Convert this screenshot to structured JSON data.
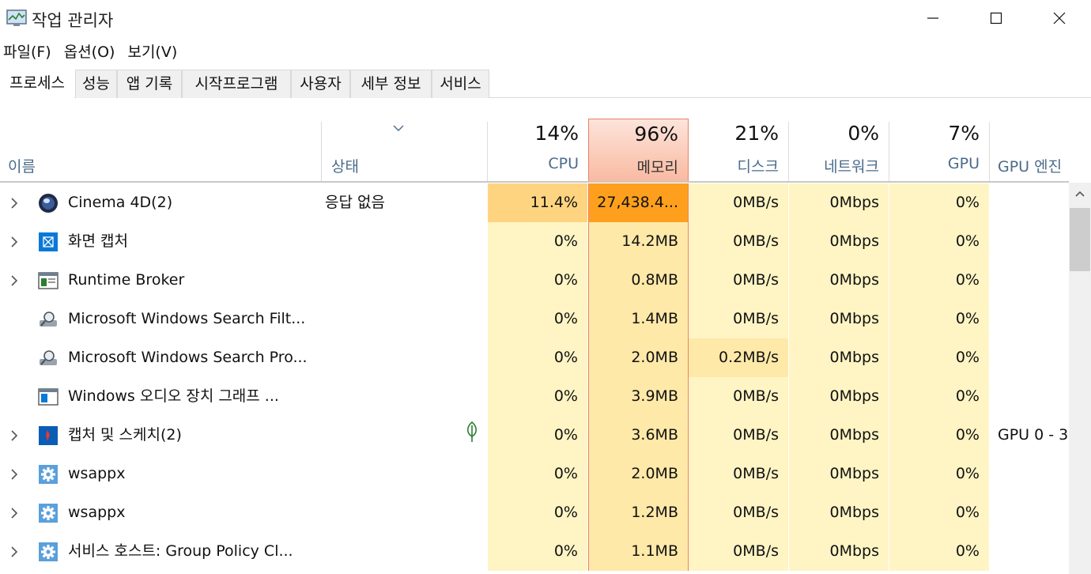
{
  "window": {
    "title": "작업 관리자"
  },
  "menu": [
    "파일(F)",
    "옵션(O)",
    "보기(V)"
  ],
  "tabs": [
    "프로세스",
    "성능",
    "앱 기록",
    "시작프로그램",
    "사용자",
    "세부 정보",
    "서비스"
  ],
  "active_tab": "프로세스",
  "columns": {
    "name": "이름",
    "status": "상태",
    "cpu": {
      "percent": "14%",
      "label": "CPU"
    },
    "memory": {
      "percent": "96%",
      "label": "메모리"
    },
    "disk": {
      "percent": "21%",
      "label": "디스크"
    },
    "network": {
      "percent": "0%",
      "label": "네트워크"
    },
    "gpu": {
      "percent": "7%",
      "label": "GPU"
    },
    "gpu_engine": {
      "label": "GPU 엔진"
    }
  },
  "processes": [
    {
      "name": "Cinema 4D(2)",
      "status": "응답 없음",
      "cpu": "11.4%",
      "memory": "27,438.4...",
      "disk": "0MB/s",
      "network": "0Mbps",
      "gpu": "0%",
      "gpu_engine": "",
      "expandable": true,
      "icon": "cinema4d-icon"
    },
    {
      "name": "화면 캡처",
      "status": "",
      "cpu": "0%",
      "memory": "14.2MB",
      "disk": "0MB/s",
      "network": "0Mbps",
      "gpu": "0%",
      "gpu_engine": "",
      "expandable": true,
      "icon": "screen-capture-icon"
    },
    {
      "name": "Runtime Broker",
      "status": "",
      "cpu": "0%",
      "memory": "0.8MB",
      "disk": "0MB/s",
      "network": "0Mbps",
      "gpu": "0%",
      "gpu_engine": "",
      "expandable": true,
      "icon": "runtime-broker-icon"
    },
    {
      "name": "Microsoft Windows Search Filt...",
      "status": "",
      "cpu": "0%",
      "memory": "1.4MB",
      "disk": "0MB/s",
      "network": "0Mbps",
      "gpu": "0%",
      "gpu_engine": "",
      "expandable": false,
      "icon": "search-filter-icon"
    },
    {
      "name": "Microsoft Windows Search Pro...",
      "status": "",
      "cpu": "0%",
      "memory": "2.0MB",
      "disk": "0.2MB/s",
      "network": "0Mbps",
      "gpu": "0%",
      "gpu_engine": "",
      "expandable": false,
      "icon": "search-protocol-icon"
    },
    {
      "name": "Windows 오디오 장치 그래프 ...",
      "status": "",
      "cpu": "0%",
      "memory": "3.9MB",
      "disk": "0MB/s",
      "network": "0Mbps",
      "gpu": "0%",
      "gpu_engine": "",
      "expandable": false,
      "icon": "audio-graph-icon"
    },
    {
      "name": "캡처 및 스케치(2)",
      "status": "",
      "cpu": "0%",
      "memory": "3.6MB",
      "disk": "0MB/s",
      "network": "0Mbps",
      "gpu": "0%",
      "gpu_engine": "GPU 0 - 3",
      "expandable": true,
      "icon": "snip-sketch-icon",
      "suspended": true
    },
    {
      "name": "wsappx",
      "status": "",
      "cpu": "0%",
      "memory": "2.0MB",
      "disk": "0MB/s",
      "network": "0Mbps",
      "gpu": "0%",
      "gpu_engine": "",
      "expandable": true,
      "icon": "gear-icon"
    },
    {
      "name": "wsappx",
      "status": "",
      "cpu": "0%",
      "memory": "1.2MB",
      "disk": "0MB/s",
      "network": "0Mbps",
      "gpu": "0%",
      "gpu_engine": "",
      "expandable": true,
      "icon": "gear-icon"
    },
    {
      "name": "서비스 호스트: Group Policy Cl...",
      "status": "",
      "cpu": "0%",
      "memory": "1.1MB",
      "disk": "0MB/s",
      "network": "0Mbps",
      "gpu": "0%",
      "gpu_engine": "",
      "expandable": true,
      "icon": "gear-icon"
    }
  ],
  "colors": {
    "heat_light": "#fff4c4",
    "heat_medium": "#ffe9a8",
    "heat_high": "#ffd480",
    "heat_critical": "#fea01e",
    "memory_header_top": "#fde4db",
    "memory_header_bottom": "#f9b9a0",
    "memory_border": "#e8826a"
  }
}
